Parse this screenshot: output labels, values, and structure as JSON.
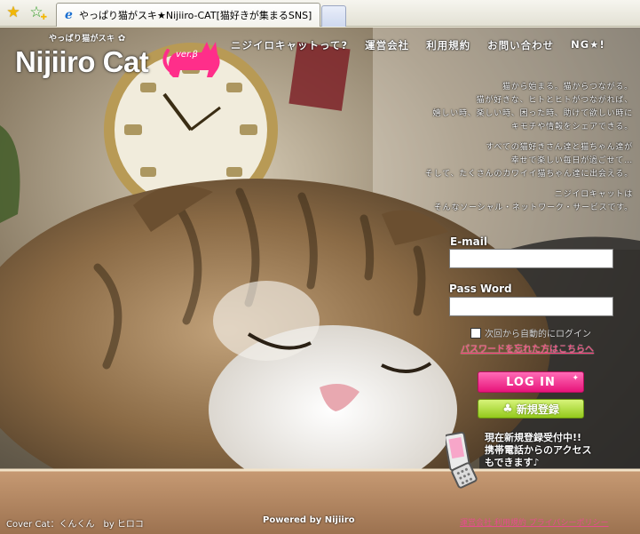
{
  "browser": {
    "tab_title": "やっぱり猫がスキ★Nijiiro-CAT[猫好きが集まるSNS]",
    "icons": {
      "favorites": "star-icon",
      "add_favorite": "add-favorite-icon",
      "tab": "ie-icon"
    }
  },
  "logo": {
    "tagline": "やっぱり猫がスキ",
    "name": "Nijiiro Cat",
    "version": "ver.β",
    "accent_color": "#ff2e8a"
  },
  "nav": [
    {
      "label": "ニジイロキャットって?"
    },
    {
      "label": "運営会社"
    },
    {
      "label": "利用規約"
    },
    {
      "label": "お問い合わせ"
    },
    {
      "label": "NG★!"
    }
  ],
  "intro": {
    "p1": "猫から始まる。猫からつながる。\n猫が好きな、ヒトとヒトがつながれば、\n嬉しい時、楽しい時、困った時、助けて欲しい時に\nキモチや情報をシェアできる。",
    "p2": "すべての猫好きさん達と猫ちゃん達が\n幸せで楽しい毎日が過ごせて…\nそして、たくさんのカワイイ猫ちゃん達に出会える。",
    "p3": "ニジイロキャットは\nそんなソーシャル・ネットワーク・サービスです。"
  },
  "login": {
    "email_label": "E-mail",
    "email_value": "",
    "password_label": "Pass Word",
    "password_value": "",
    "remember_label": "次回から自動的にログイン",
    "forgot_link": "パスワードを忘れた方はこちらへ",
    "login_button": "LOG IN",
    "register_button": "新規登録",
    "login_color": "#e7147a",
    "register_color": "#94c91c"
  },
  "mobile": {
    "text": "現在新規登録受付中!!\n携帯電話からのアクセス\nもできます♪"
  },
  "footer": {
    "cover_cat": "Cover Cat：くんくん　by ヒロコ",
    "powered": "Powered by Nijiiro",
    "links": "運営会社  利用規約  プライバシーポリシー"
  }
}
